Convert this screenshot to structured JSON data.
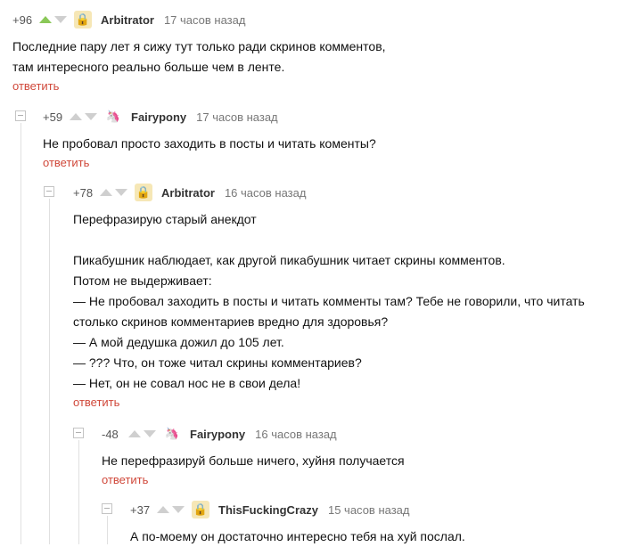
{
  "comments": [
    {
      "rating": "+96",
      "upvoted": true,
      "username": "Arbitrator",
      "avatar": "arbitrator-avatar",
      "time": "17 часов назад",
      "body": "Последние пару лет я сижу тут только ради скринов комментов,\nтам интересного реально больше чем в ленте.",
      "reply": "ответить"
    },
    {
      "rating": "+59",
      "upvoted": false,
      "username": "Fairypony",
      "avatar": "pony-avatar",
      "time": "17 часов назад",
      "body": "Не пробовал просто заходить в посты и читать коменты?",
      "reply": "ответить"
    },
    {
      "rating": "+78",
      "upvoted": false,
      "username": "Arbitrator",
      "avatar": "arbitrator-avatar",
      "time": "16 часов назад",
      "body": "Перефразирую старый анекдот\n\nПикабушник наблюдает, как другой пикабушник читает скрины комментов.\nПотом не выдерживает:\n— Не пробовал заходить в посты и читать комменты там? Тебе не говорили, что читать\nстолько скринов комментариев вредно для здоровья?\n— А мой дедушка дожил до 105 лет.\n— ??? Что, он тоже читал скрины комментариев?\n— Нет, он не совал нос не в свои дела!",
      "reply": "ответить"
    },
    {
      "rating": "-48",
      "upvoted": false,
      "username": "Fairypony",
      "avatar": "pony-avatar",
      "time": "16 часов назад",
      "body": "Не перефразируй больше ничего, хуйня получается",
      "reply": "ответить"
    },
    {
      "rating": "+37",
      "upvoted": false,
      "username": "ThisFuckingCrazy",
      "avatar": "crazy-avatar",
      "time": "15 часов назад",
      "body": "А по-моему он достаточно интересно тебя на хуй послал.",
      "reply": ""
    }
  ],
  "colors": {
    "accent": "#d0483a",
    "upvote": "#8ac858"
  }
}
